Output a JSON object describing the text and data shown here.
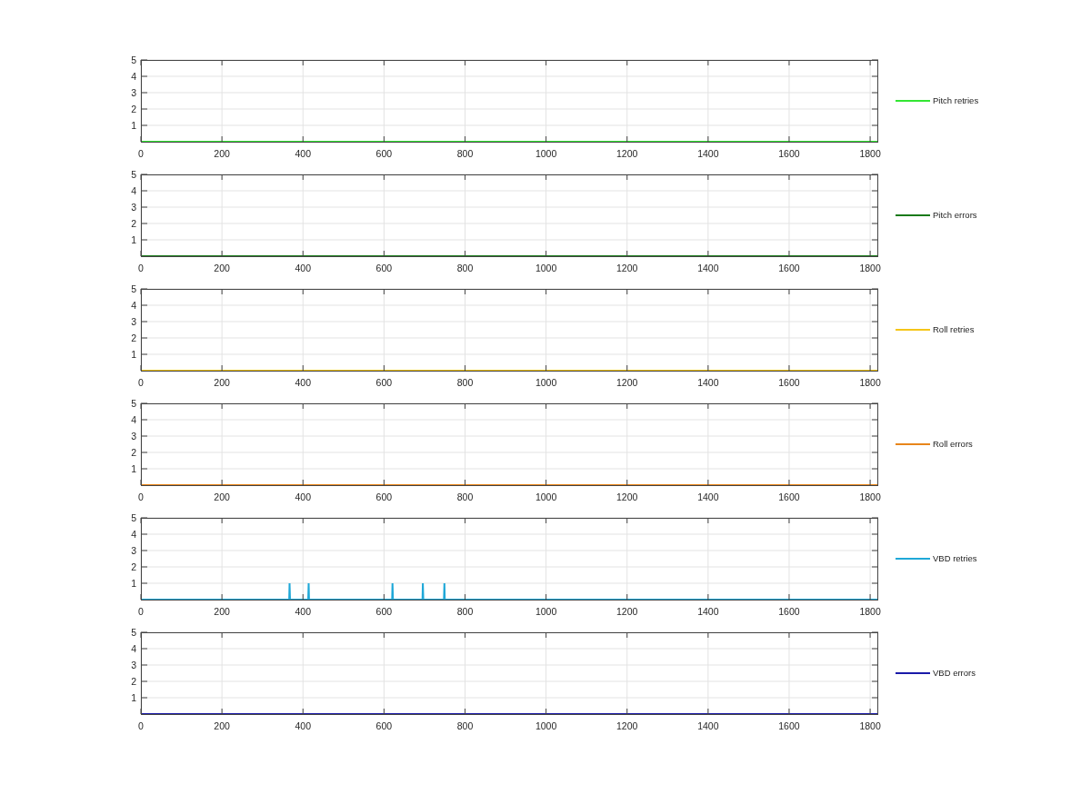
{
  "charts": [
    {
      "chart_data": {
        "type": "line",
        "grid": true,
        "xlim": [
          0,
          1820
        ],
        "ylim": [
          0,
          5
        ],
        "xticks": [
          0,
          200,
          400,
          600,
          800,
          1000,
          1200,
          1400,
          1600,
          1800
        ],
        "yticks": [
          1,
          2,
          3,
          4,
          5
        ],
        "x": [
          0,
          1820
        ],
        "series": [
          {
            "name": "Pitch retries",
            "color": "#33e633",
            "values": [
              0,
              0
            ]
          }
        ]
      }
    },
    {
      "chart_data": {
        "type": "line",
        "grid": true,
        "xlim": [
          0,
          1820
        ],
        "ylim": [
          0,
          5
        ],
        "xticks": [
          0,
          200,
          400,
          600,
          800,
          1000,
          1200,
          1400,
          1600,
          1800
        ],
        "yticks": [
          1,
          2,
          3,
          4,
          5
        ],
        "x": [
          0,
          1820
        ],
        "series": [
          {
            "name": "Pitch errors",
            "color": "#1a7a1a",
            "values": [
              0,
              0
            ]
          }
        ]
      }
    },
    {
      "chart_data": {
        "type": "line",
        "grid": true,
        "xlim": [
          0,
          1820
        ],
        "ylim": [
          0,
          5
        ],
        "xticks": [
          0,
          200,
          400,
          600,
          800,
          1000,
          1200,
          1400,
          1600,
          1800
        ],
        "yticks": [
          1,
          2,
          3,
          4,
          5
        ],
        "x": [
          0,
          1820
        ],
        "series": [
          {
            "name": "Roll retries",
            "color": "#f5c518",
            "values": [
              0,
              0
            ]
          }
        ]
      }
    },
    {
      "chart_data": {
        "type": "line",
        "grid": true,
        "xlim": [
          0,
          1820
        ],
        "ylim": [
          0,
          5
        ],
        "xticks": [
          0,
          200,
          400,
          600,
          800,
          1000,
          1200,
          1400,
          1600,
          1800
        ],
        "yticks": [
          1,
          2,
          3,
          4,
          5
        ],
        "x": [
          0,
          1820
        ],
        "series": [
          {
            "name": "Roll errors",
            "color": "#e8861a",
            "values": [
              0,
              0
            ]
          }
        ]
      }
    },
    {
      "chart_data": {
        "type": "line",
        "grid": true,
        "xlim": [
          0,
          1820
        ],
        "ylim": [
          0,
          5
        ],
        "xticks": [
          0,
          200,
          400,
          600,
          800,
          1000,
          1200,
          1400,
          1600,
          1800
        ],
        "yticks": [
          1,
          2,
          3,
          4,
          5
        ],
        "x": [
          0,
          366,
          367,
          368,
          413,
          414,
          415,
          620,
          621,
          622,
          695,
          696,
          697,
          748,
          749,
          750,
          1820
        ],
        "series": [
          {
            "name": "VBD retries",
            "color": "#1fa8d8",
            "values": [
              0,
              0,
              1,
              0,
              0,
              1,
              0,
              0,
              1,
              0,
              0,
              1,
              0,
              0,
              1,
              0,
              0
            ]
          }
        ]
      }
    },
    {
      "chart_data": {
        "type": "line",
        "grid": true,
        "xlim": [
          0,
          1820
        ],
        "ylim": [
          0,
          5
        ],
        "xticks": [
          0,
          200,
          400,
          600,
          800,
          1000,
          1200,
          1400,
          1600,
          1800
        ],
        "yticks": [
          1,
          2,
          3,
          4,
          5
        ],
        "x": [
          0,
          1820
        ],
        "series": [
          {
            "name": "VBD errors",
            "color": "#1a1aa8",
            "values": [
              0,
              0
            ]
          }
        ]
      }
    }
  ]
}
